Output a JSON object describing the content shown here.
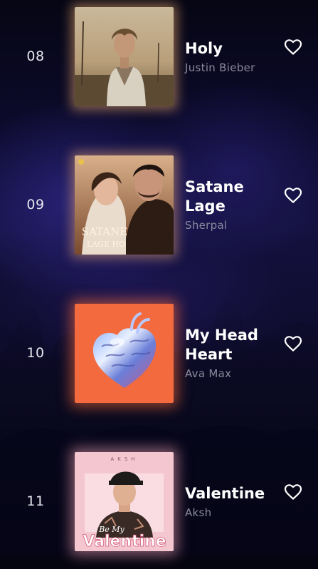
{
  "tracks": [
    {
      "rank": "08",
      "title": "Holy",
      "artist": "Justin Bieber",
      "favorite_icon": "heart-outline-icon"
    },
    {
      "rank": "09",
      "title": "Satane Lage",
      "artist": "Sherpal",
      "cover_text": "SATANE LAGE HO",
      "favorite_icon": "heart-outline-icon"
    },
    {
      "rank": "10",
      "title": "My Head Heart",
      "artist": "Ava Max",
      "favorite_icon": "heart-outline-icon"
    },
    {
      "rank": "11",
      "title": "Valentine",
      "artist": "Aksh",
      "cover_text": "Valentine",
      "cover_top_text": "AKSH",
      "favorite_icon": "heart-outline-icon"
    }
  ],
  "colors": {
    "background": "#07071a",
    "title": "#ffffff",
    "artist": "#8a8a9c",
    "rank": "#e6e6ee"
  }
}
